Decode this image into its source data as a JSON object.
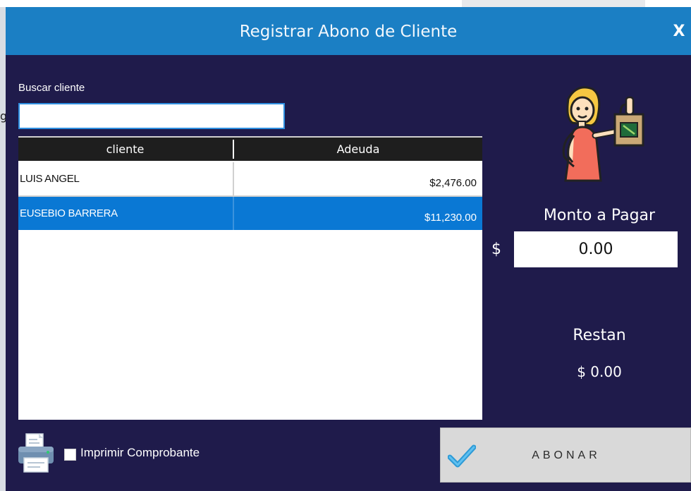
{
  "window": {
    "title": "Registrar Abono de Cliente",
    "close_label": "X"
  },
  "search": {
    "label": "Buscar cliente",
    "value": "",
    "placeholder": ""
  },
  "grid": {
    "columns": [
      "cliente",
      "Adeuda"
    ],
    "rows": [
      {
        "cliente": "LUIS ANGEL",
        "adeuda": "$2,476.00",
        "selected": false
      },
      {
        "cliente": "EUSEBIO BARRERA",
        "adeuda": "$11,230.00",
        "selected": true
      }
    ]
  },
  "print_option": {
    "label": "Imprimir Comprobante",
    "checked": false
  },
  "payment": {
    "monto_label": "Monto a Pagar",
    "currency_symbol": "$",
    "monto_value": "0.00",
    "restan_label": "Restan",
    "restan_value": "$ 0.00"
  },
  "actions": {
    "abonar_label": "ABONAR"
  },
  "icons": {
    "print": "printer-icon",
    "confirm": "checkmark-icon",
    "customer": "shopping-woman-icon"
  },
  "colors": {
    "titlebar": "#1b7fc4",
    "background": "#1f1b4b",
    "selected_row": "#0a78d4",
    "grid_header": "#1e1e1e",
    "button": "#d9d9d9"
  }
}
